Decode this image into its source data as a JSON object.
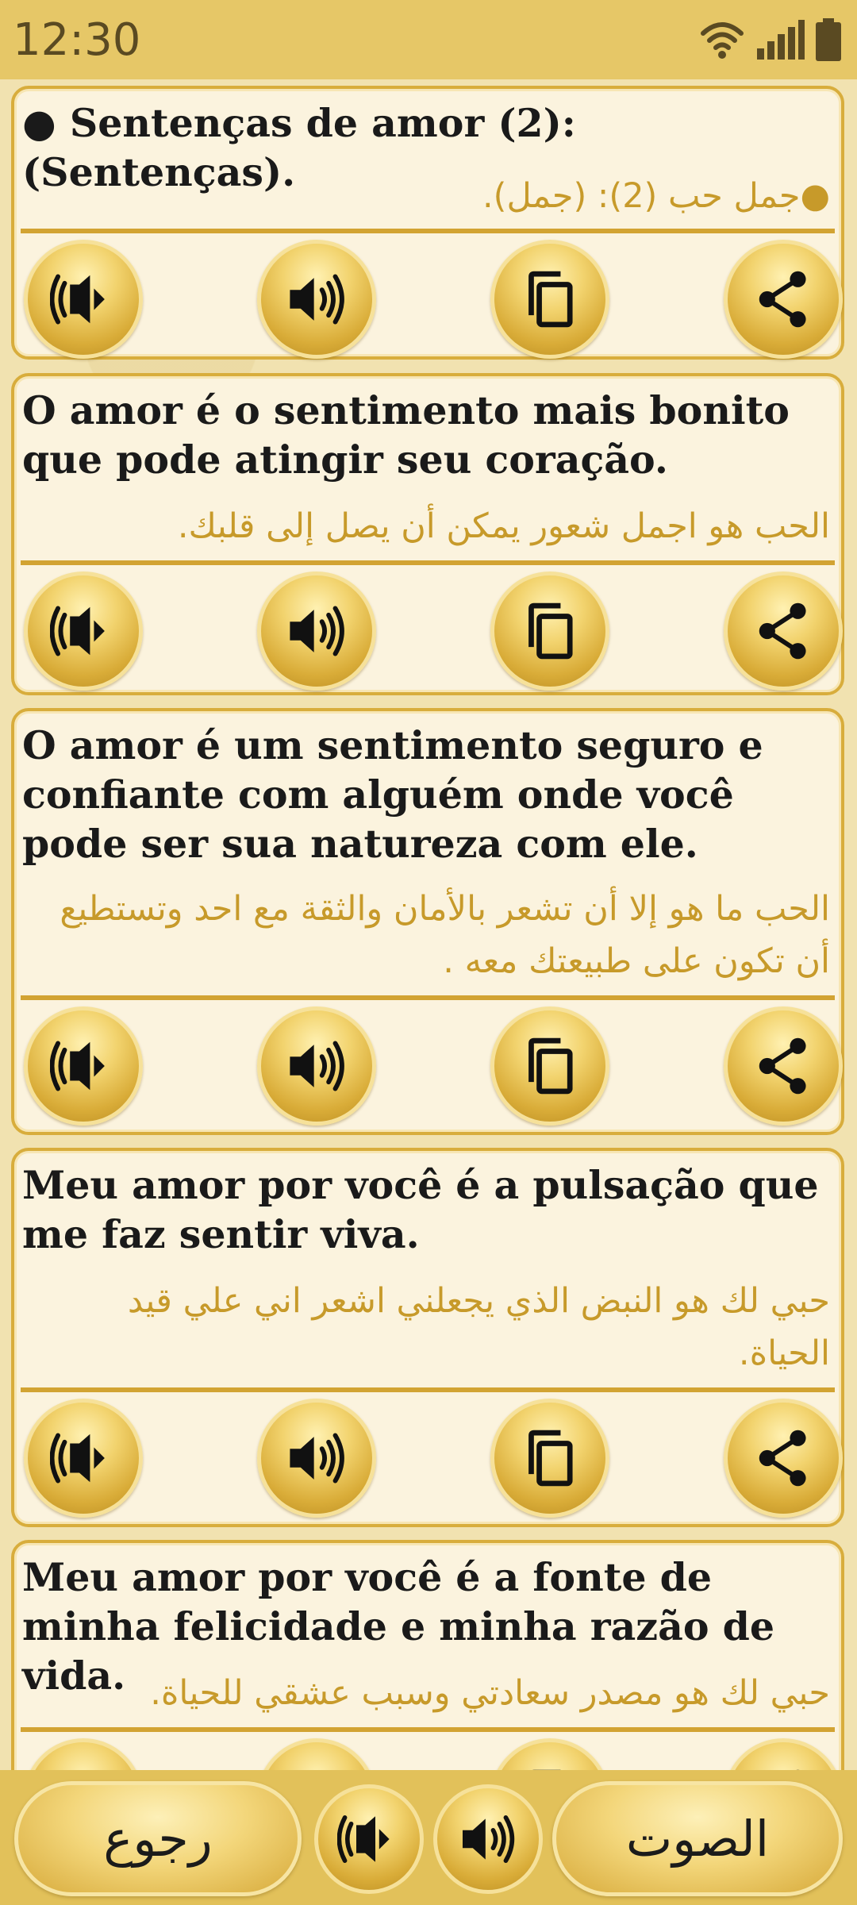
{
  "status_bar": {
    "time": "12:30"
  },
  "cards": [
    {
      "portuguese": "● Sentenças de amor (2): (Sentenças).",
      "arabic": "●جمل حب (2): (جمل)."
    },
    {
      "portuguese": "O amor é o sentimento mais bonito que pode atingir seu coração.",
      "arabic": "الحب هو اجمل شعور يمكن أن يصل إلى قلبك."
    },
    {
      "portuguese": "O amor é um sentimento seguro e confiante com alguém onde você pode ser sua natureza com ele.",
      "arabic": "الحب ما هو  إلا أن تشعر بالأمان والثقة مع احد وتستطيع أن تكون على طبيعتك معه ."
    },
    {
      "portuguese": "Meu amor por você é a pulsação que me faz sentir viva.",
      "arabic": "حبي لك هو النبض الذي يجعلني اشعر اني علي قيد الحياة."
    },
    {
      "portuguese": "Meu amor por você é a fonte de minha felicidade e minha razão de vida.",
      "arabic": "حبي لك هو مصدر سعادتي وسبب عشقي للحياة."
    }
  ],
  "action_icons": [
    "slow-speaker-icon",
    "speaker-icon",
    "copy-icon",
    "share-icon"
  ],
  "bottom_bar": {
    "back_label": "رجوع",
    "sound_label": "الصوت"
  },
  "colors": {
    "accent_gold": "#d8ad3c",
    "arabic_text": "#c79a2a",
    "status_bar": "#e6c767"
  }
}
